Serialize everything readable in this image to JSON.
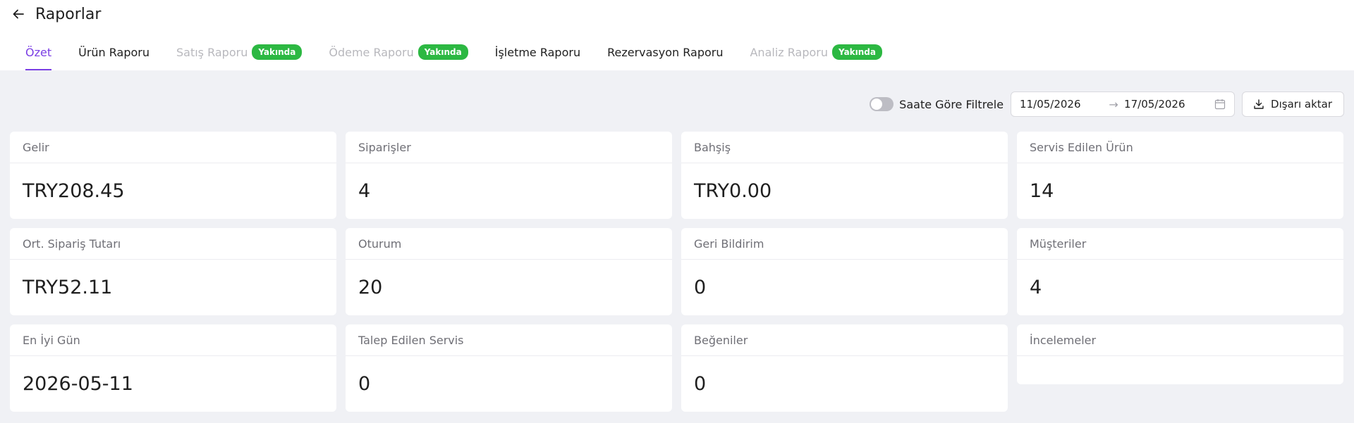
{
  "header": {
    "title": "Raporlar"
  },
  "tabs": [
    {
      "label": "Özet",
      "state": "active"
    },
    {
      "label": "Ürün Raporu",
      "state": "normal"
    },
    {
      "label": "Satış Raporu",
      "state": "disabled",
      "badge": "Yakında"
    },
    {
      "label": "Ödeme Raporu",
      "state": "disabled",
      "badge": "Yakında"
    },
    {
      "label": "İşletme Raporu",
      "state": "normal"
    },
    {
      "label": "Rezervasyon Raporu",
      "state": "normal"
    },
    {
      "label": "Analiz Raporu",
      "state": "disabled",
      "badge": "Yakında"
    }
  ],
  "filters": {
    "hour_filter_label": "Saate Göre Filtrele",
    "hour_filter_on": false,
    "start_date": "11/05/2026",
    "end_date": "17/05/2026",
    "export_label": "Dışarı aktar"
  },
  "metrics": [
    {
      "label": "Gelir",
      "value": "TRY208.45"
    },
    {
      "label": "Siparişler",
      "value": "4"
    },
    {
      "label": "Bahşiş",
      "value": "TRY0.00"
    },
    {
      "label": "Servis Edilen Ürün",
      "value": "14"
    },
    {
      "label": "Ort. Sipariş Tutarı",
      "value": "TRY52.11"
    },
    {
      "label": "Oturum",
      "value": "20"
    },
    {
      "label": "Geri Bildirim",
      "value": "0"
    },
    {
      "label": "Müşteriler",
      "value": "4"
    },
    {
      "label": "En İyi Gün",
      "value": "2026-05-11"
    },
    {
      "label": "Talep Edilen Servis",
      "value": "0"
    },
    {
      "label": "Beğeniler",
      "value": "0"
    },
    {
      "label": "İncelemeler",
      "value": ""
    }
  ],
  "colors": {
    "accent": "#7b3fe4",
    "badge": "#2cb842",
    "background": "#f0f1f5"
  }
}
